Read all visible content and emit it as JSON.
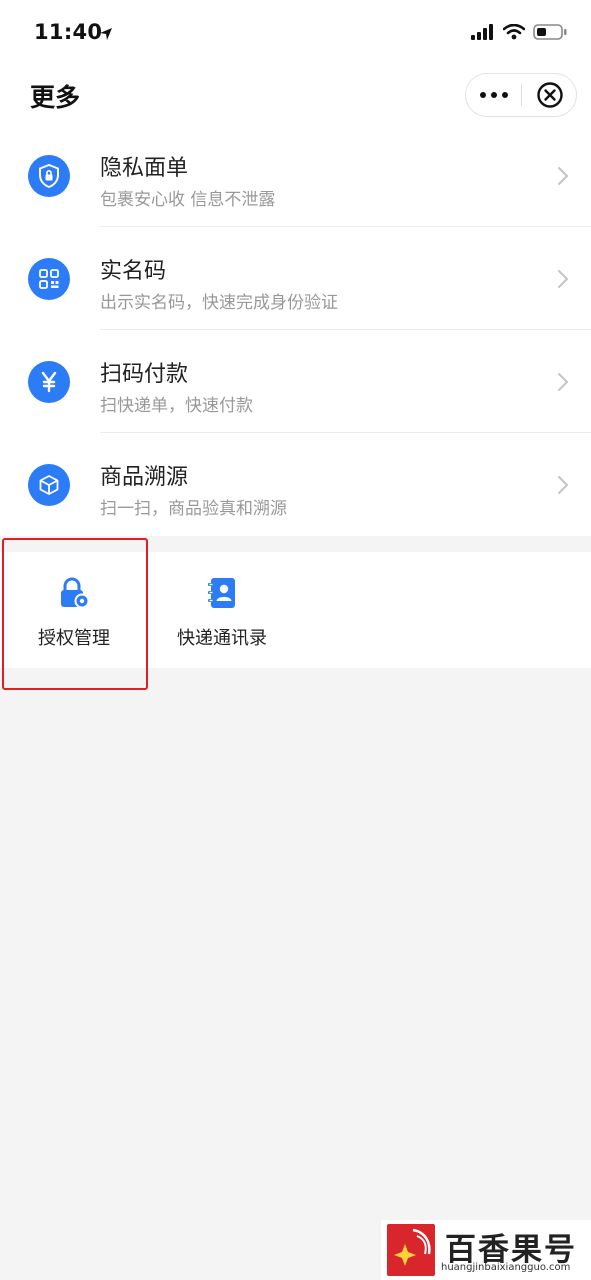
{
  "status_bar": {
    "time": "11:40"
  },
  "nav": {
    "title": "更多"
  },
  "list_items": [
    {
      "title": "隐私面单",
      "subtitle": "包裹安心收 信息不泄露",
      "icon": "lock-shield-icon"
    },
    {
      "title": "实名码",
      "subtitle": "出示实名码，快速完成身份验证",
      "icon": "qr-code-icon"
    },
    {
      "title": "扫码付款",
      "subtitle": "扫快递单，快速付款",
      "icon": "yuan-icon"
    },
    {
      "title": "商品溯源",
      "subtitle": "扫一扫，商品验真和溯源",
      "icon": "box-icon"
    }
  ],
  "grid_items": [
    {
      "label": "授权管理",
      "icon": "lock-gear-icon"
    },
    {
      "label": "快递通讯录",
      "icon": "contact-book-icon"
    }
  ],
  "watermark": {
    "brand": "百香果号",
    "url": "huangjinbaixiangguo.com"
  },
  "colors": {
    "accent": "#2c7cf6",
    "highlight": "#e02020",
    "background": "#f4f4f4"
  }
}
